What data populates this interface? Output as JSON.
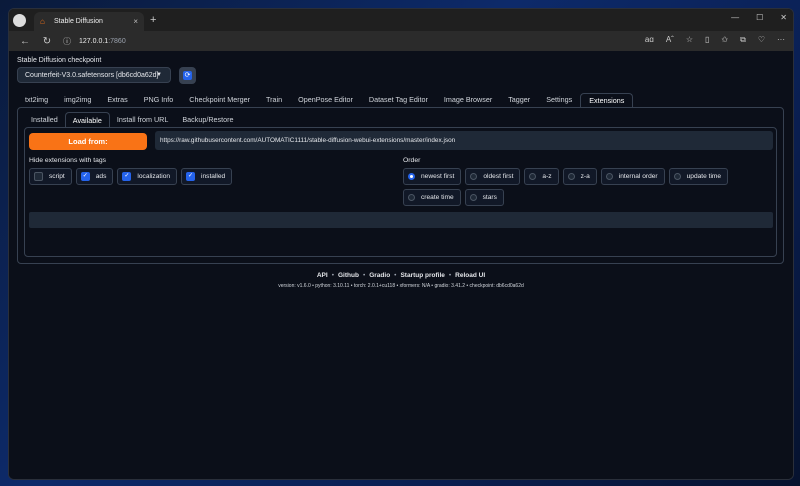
{
  "browser": {
    "tab_title": "Stable Diffusion",
    "tab_icon": "⌂",
    "new_tab": "+",
    "close_tab": "×",
    "url_host": "127.0.0.1",
    "url_port": ":7860",
    "window_controls": [
      "—",
      "☐",
      "✕"
    ],
    "toolbar_icons": [
      "aɑ",
      "Aˆ",
      "☆",
      "▯",
      "✩",
      "⧉",
      "♡",
      "···"
    ]
  },
  "checkpoint": {
    "label": "Stable Diffusion checkpoint",
    "value": "Counterfeit-V3.0.safetensors [db6cd0a62d]"
  },
  "main_tabs": [
    "txt2img",
    "img2img",
    "Extras",
    "PNG Info",
    "Checkpoint Merger",
    "Train",
    "OpenPose Editor",
    "Dataset Tag Editor",
    "Image Browser",
    "Tagger",
    "Settings",
    "Extensions"
  ],
  "active_main_tab": "Extensions",
  "sub_tabs": [
    "Installed",
    "Available",
    "Install from URL",
    "Backup/Restore"
  ],
  "active_sub_tab": "Available",
  "available": {
    "load_button": "Load from:",
    "url": "https://raw.githubusercontent.com/AUTOMATIC1111/stable-diffusion-webui-extensions/master/index.json",
    "hide_label": "Hide extensions with tags",
    "tags": [
      {
        "label": "script",
        "checked": false
      },
      {
        "label": "ads",
        "checked": true
      },
      {
        "label": "localization",
        "checked": true
      },
      {
        "label": "installed",
        "checked": true
      }
    ],
    "order_label": "Order",
    "order_options": [
      {
        "label": "newest first",
        "selected": true
      },
      {
        "label": "oldest first",
        "selected": false
      },
      {
        "label": "a-z",
        "selected": false
      },
      {
        "label": "z-a",
        "selected": false
      },
      {
        "label": "internal order",
        "selected": false
      },
      {
        "label": "update time",
        "selected": false
      },
      {
        "label": "create time",
        "selected": false
      },
      {
        "label": "stars",
        "selected": false
      }
    ]
  },
  "footer": {
    "links": [
      "API",
      "Github",
      "Gradio",
      "Startup profile",
      "Reload UI"
    ],
    "versions": "version: v1.6.0  •  python: 3.10.11  •  torch: 2.0.1+cu118  •  xformers: N/A  •  gradio: 3.41.2  •  checkpoint: db6cd0a62d"
  },
  "colors": {
    "accent": "#f97316",
    "checkbox": "#2563eb",
    "background": "#0b0f19"
  }
}
